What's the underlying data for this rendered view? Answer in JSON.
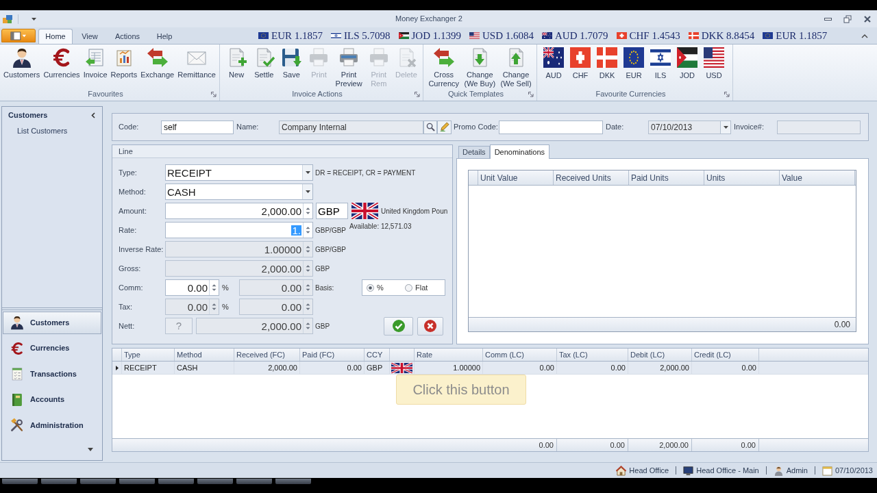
{
  "window": {
    "title": "Money Exchanger 2"
  },
  "ribbon_tabs": [
    {
      "label": "Home",
      "selected": true
    },
    {
      "label": "View",
      "selected": false
    },
    {
      "label": "Actions",
      "selected": false
    },
    {
      "label": "Help",
      "selected": false
    }
  ],
  "rate_ticker": [
    {
      "text": "EUR 1.1857"
    },
    {
      "text": "ILS 5.7098"
    },
    {
      "text": "JOD 1.1399"
    },
    {
      "text": "USD 1.6084"
    },
    {
      "text": "AUD 1.7079"
    },
    {
      "text": "CHF 1.4543"
    },
    {
      "text": "DKK 8.8454"
    },
    {
      "text": "EUR 1.1857"
    }
  ],
  "ribbon_groups": [
    {
      "label": "Favourites",
      "buttons": [
        {
          "label": "Customers"
        },
        {
          "label": "Currencies"
        },
        {
          "label": "Invoice"
        },
        {
          "label": "Reports"
        },
        {
          "label": "Exchange"
        },
        {
          "label": "Remittance"
        }
      ]
    },
    {
      "label": "Invoice Actions",
      "buttons": [
        {
          "label": "New",
          "disabled": false
        },
        {
          "label": "Settle",
          "disabled": false
        },
        {
          "label": "Save",
          "disabled": false
        },
        {
          "label": "Print",
          "disabled": true
        },
        {
          "label": "Print\nPreview",
          "disabled": false
        },
        {
          "label": "Print\nRem",
          "disabled": true
        },
        {
          "label": "Delete",
          "disabled": true
        }
      ]
    },
    {
      "label": "Quick Templates",
      "buttons": [
        {
          "label": "Cross\nCurrency"
        },
        {
          "label": "Change\n(We Buy)"
        },
        {
          "label": "Change\n(We Sell)"
        }
      ]
    },
    {
      "label": "Favourite Currencies",
      "buttons": [
        {
          "label": "AUD"
        },
        {
          "label": "CHF"
        },
        {
          "label": "DKK"
        },
        {
          "label": "EUR"
        },
        {
          "label": "ILS"
        },
        {
          "label": "JOD"
        },
        {
          "label": "USD"
        }
      ]
    }
  ],
  "sidebar": {
    "title": "Customers",
    "links": [
      "List Customers"
    ],
    "nav": [
      {
        "label": "Customers",
        "selected": true
      },
      {
        "label": "Currencies",
        "selected": false
      },
      {
        "label": "Transactions",
        "selected": false
      },
      {
        "label": "Accounts",
        "selected": false
      },
      {
        "label": "Administration",
        "selected": false
      }
    ]
  },
  "header": {
    "code": {
      "label": "Code:",
      "value": "self",
      "disabled": false
    },
    "name": {
      "label": "Name:",
      "value": "Company Internal",
      "disabled": true
    },
    "promo_code": {
      "label": "Promo Code:",
      "disabled": false
    },
    "date": {
      "label": "Date:",
      "value": "07/10/2013",
      "disabled": true
    },
    "invoice": {
      "label": "Invoice#:",
      "disabled": true
    }
  },
  "line_panel": {
    "title": "Line",
    "rows": [
      {
        "kind": "dropdown",
        "label": "Type:",
        "value": "RECEIPT",
        "note": "DR = RECEIPT, CR = PAYMENT"
      },
      {
        "kind": "dropdown",
        "label": "Method:",
        "value": "CASH"
      },
      {
        "kind": "amount",
        "label": "Amount:",
        "value": "2,000.00",
        "currency": "GBP",
        "currency_name": "United Kingdom Poun"
      },
      {
        "kind": "spin",
        "label": "Rate:",
        "value": "1.",
        "highlighted": true,
        "disabled": false,
        "unit": "GBP/GBP",
        "available": "Available: 12,571.03"
      },
      {
        "kind": "spin",
        "label": "Inverse Rate:",
        "value": "1.00000",
        "highlighted": false,
        "disabled": true,
        "unit": "GBP/GBP"
      },
      {
        "kind": "spin",
        "label": "Gross:",
        "value": "2,000.00",
        "highlighted": false,
        "disabled": true,
        "unit": "GBP"
      },
      {
        "kind": "split",
        "label": "Comm:",
        "percent": "0.00",
        "percent_disabled": false,
        "percent_sign": "%",
        "amount": "0.00",
        "amount_disabled": true,
        "basis": {
          "label": "Basis:",
          "options": [
            {
              "label": "%",
              "selected": true
            },
            {
              "label": "Flat",
              "selected": false
            }
          ]
        }
      },
      {
        "kind": "split",
        "label": "Tax:",
        "percent": "0.00",
        "percent_disabled": true,
        "percent_sign": "%",
        "amount": "0.00",
        "amount_disabled": true
      },
      {
        "kind": "nett",
        "label": "Nett:",
        "help": "?",
        "value": "2,000.00",
        "disabled": true,
        "unit": "GBP"
      }
    ],
    "buttons": [
      {
        "kind": "confirm"
      },
      {
        "kind": "cancel"
      }
    ]
  },
  "details_tabs": [
    {
      "label": "Details",
      "selected": false
    },
    {
      "label": "Denominations",
      "selected": true
    }
  ],
  "denominations": {
    "columns": [
      "Unit Value",
      "Received Units",
      "Paid Units",
      "Units",
      "Value"
    ],
    "total": "0.00"
  },
  "lines_grid": {
    "columns": [
      "Type",
      "Method",
      "Received (FC)",
      "Paid (FC)",
      "CCY",
      "Rate",
      "Comm (LC)",
      "Tax (LC)",
      "Debit (LC)",
      "Credit (LC)"
    ],
    "rows": [
      {
        "selected": true,
        "cells": [
          "RECEIPT",
          "CASH",
          "2,000.00",
          "0.00",
          "GBP",
          "1.00000",
          "0.00",
          "0.00",
          "2,000.00",
          "0.00"
        ]
      }
    ],
    "totals": [
      "0.00",
      "0.00",
      "2,000.00",
      "0.00"
    ]
  },
  "tooltip": {
    "text": "Click this button"
  },
  "status_bar": [
    {
      "text": "Head Office"
    },
    {
      "text": "Head Office - Main"
    },
    {
      "text": "Admin"
    },
    {
      "text": "07/10/2013"
    }
  ]
}
